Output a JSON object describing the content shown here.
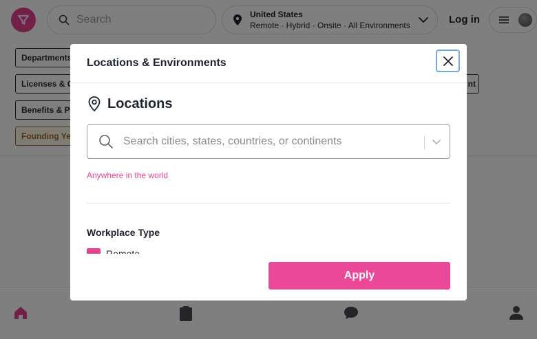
{
  "colors": {
    "brand_pink": "#e5418f",
    "apply_pink": "#ec4899",
    "focus_ring": "#6fa8dc"
  },
  "header": {
    "search_placeholder": "Search",
    "location": {
      "title": "United States",
      "subtitle": "Remote · Hybrid · Onsite · All Environments"
    },
    "login_label": "Log in"
  },
  "chips": {
    "departments": "Departments",
    "licenses": "Licenses & C",
    "benefits": "Benefits & P",
    "founding": "Founding Ye",
    "partial_right": "nt"
  },
  "modal": {
    "title": "Locations & Environments",
    "locations_heading": "Locations",
    "location_search_placeholder": "Search cities, states, countries, or continents",
    "anywhere_text": "Anywhere in the world",
    "workplace_heading": "Workplace Type",
    "workplace_first_option": "Remote",
    "apply_label": "Apply"
  },
  "icons": {
    "logo": "filter-funnel-icon",
    "search": "search-icon",
    "location": "map-pin-icon",
    "close": "close-icon",
    "nav": [
      "home-icon",
      "clipboard-icon",
      "chat-icon",
      "user-icon"
    ]
  }
}
